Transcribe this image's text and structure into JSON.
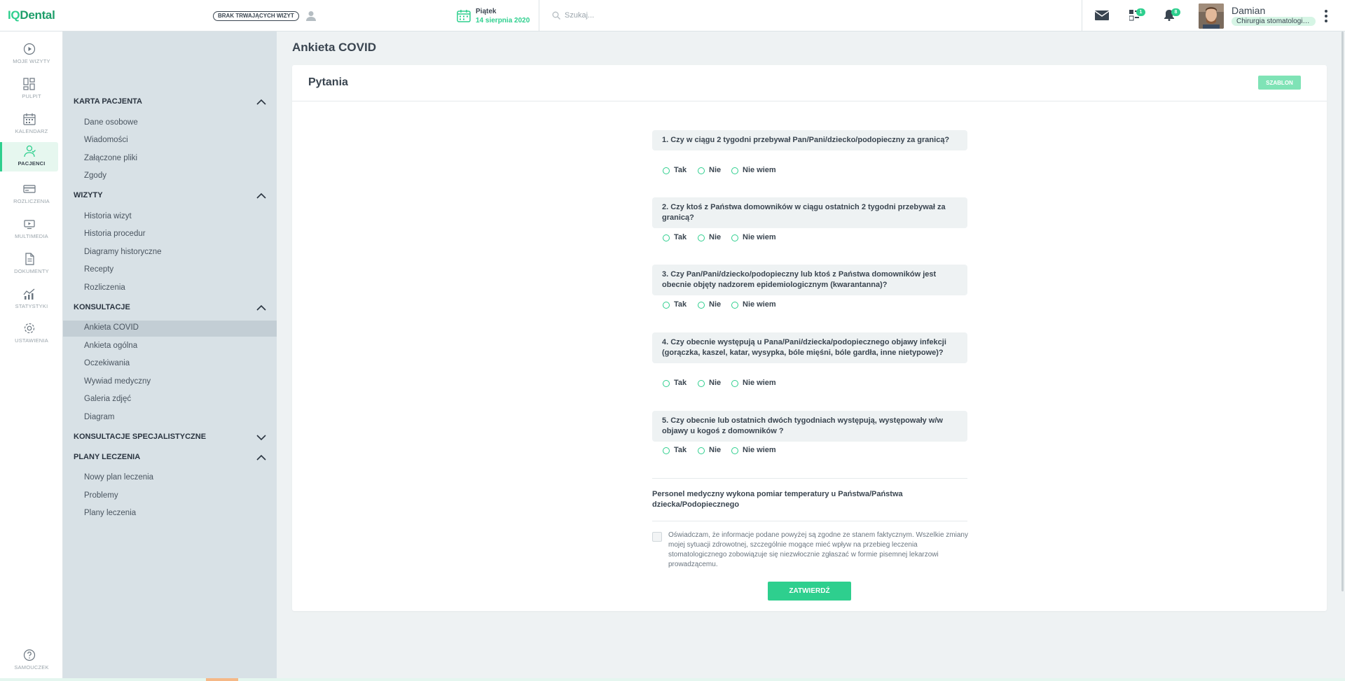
{
  "app": {
    "logo_main": "IQ",
    "logo_rest": "Dental",
    "brand_color": "#2ecf8e"
  },
  "topbar": {
    "visit_badge": "BRAK TRWAJĄCYCH WIZYT",
    "day": "Piątek",
    "date": "14 sierpnia 2020",
    "search_placeholder": "Szukaj...",
    "tasks_count": "1",
    "notifications_count": "8",
    "user_name": "Damian",
    "user_role": "Chirurgia stomatologiczna"
  },
  "rail": [
    {
      "label": "MOJE WIZYTY",
      "icon": "play-circle-icon"
    },
    {
      "label": "PULPIT",
      "icon": "dashboard-icon"
    },
    {
      "label": "KALENDARZ",
      "icon": "calendar-icon"
    },
    {
      "label": "PACJENCI",
      "icon": "patients-icon"
    },
    {
      "label": "ROZLICZENIA",
      "icon": "card-icon"
    },
    {
      "label": "MULTIMEDIA",
      "icon": "media-icon"
    },
    {
      "label": "DOKUMENTY",
      "icon": "document-icon"
    },
    {
      "label": "STATYSTYKI",
      "icon": "stats-icon"
    },
    {
      "label": "USTAWIENIA",
      "icon": "gear-icon"
    },
    {
      "label": "SAMOUCZEK",
      "icon": "help-icon"
    }
  ],
  "sidebar": {
    "sections": [
      {
        "title": "KARTA PACJENTA",
        "items": [
          "Dane osobowe",
          "Wiadomości",
          "Załączone pliki",
          "Zgody"
        ]
      },
      {
        "title": "WIZYTY",
        "items": [
          "Historia wizyt",
          "Historia procedur",
          "Diagramy historyczne",
          "Recepty",
          "Rozliczenia"
        ]
      },
      {
        "title": "KONSULTACJE",
        "items": [
          "Ankieta COVID",
          "Ankieta ogólna",
          "Oczekiwania",
          "Wywiad medyczny",
          "Galeria zdjęć",
          "Diagram"
        ]
      },
      {
        "title": "KONSULTACJE SPECJALISTYCZNE",
        "items": []
      },
      {
        "title": "PLANY LECZENIA",
        "items": [
          "Nowy plan leczenia",
          "Problemy",
          "Plany leczenia"
        ]
      }
    ]
  },
  "main": {
    "page_title": "Ankieta COVID",
    "card_title": "Pytania",
    "template_button": "SZABLON",
    "options": [
      "Tak",
      "Nie",
      "Nie wiem"
    ],
    "questions": [
      "1. Czy w ciągu 2 tygodni przebywał Pan/Pani/dziecko/podopieczny za granicą?",
      "2. Czy ktoś z Państwa domowników w ciągu ostatnich 2 tygodni przebywał za granicą?",
      "3. Czy Pan/Pani/dziecko/podopieczny lub ktoś z Państwa domowników jest obecnie objęty nadzorem epidemiologicznym (kwarantanna)?",
      "4. Czy obecnie występują u Pana/Pani/dziecka/podopiecznego objawy infekcji (gorączka, kaszel, katar, wysypka, bóle mięśni, bóle gardła, inne nietypowe)?",
      "5. Czy obecnie lub ostatnich dwóch tygodniach występują, występowały w/w objawy u kogoś z domowników ?"
    ],
    "temperature_note": "Personel medyczny wykona pomiar temperatury u Państwa/Państwa dziecka/Podopiecznego",
    "declaration": "Oświadczam, że informacje podane powyżej są zgodne ze stanem faktycznym. Wszelkie zmiany mojej sytuacji zdrowotnej, szczególnie mogące mieć wpływ na przebieg leczenia stomatologicznego zobowiązuje się niezwłocznie zgłaszać w formie pisemnej lekarzowi prowadzącemu.",
    "submit_button": "ZATWIERDŹ"
  }
}
